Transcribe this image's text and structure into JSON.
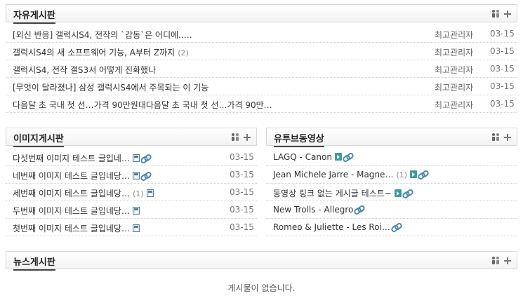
{
  "free_board": {
    "title": "자유게시판",
    "rows": [
      {
        "title": "[외신 반응] 갤럭시S4, 전작의 `감동`은 어디에..…",
        "comments": "",
        "author": "최고관리자",
        "date": "03-15"
      },
      {
        "title": "갤럭시S4의 새 소프트웨어 기능, A부터 Z까지",
        "comments": "(2)",
        "author": "최고관리자",
        "date": "03-15"
      },
      {
        "title": "갤럭시S4, 전작 갤S3서 어떻게 진화했나",
        "comments": "",
        "author": "최고관리자",
        "date": "03-15"
      },
      {
        "title": "[무엇이 달라졌나] 삼성 갤럭시S4에서 주목되는 이 기능",
        "comments": "",
        "author": "최고관리자",
        "date": "03-15"
      },
      {
        "title": "다음달 초 국내 첫 선…가격 90만원대다음달 초 국내 첫 선…가격 90만…",
        "comments": "",
        "author": "최고관리자",
        "date": "03-15"
      }
    ]
  },
  "image_board": {
    "title": "이미지게시판",
    "rows": [
      {
        "title": "다섯번째 이미지 테스트 글입네…",
        "comments": "",
        "date": "03-15",
        "icons": [
          "disk",
          "link"
        ]
      },
      {
        "title": "네번째 이미지 테스트 글입네당…",
        "comments": "",
        "date": "03-15",
        "icons": [
          "disk",
          "link"
        ]
      },
      {
        "title": "세번째 이미지 테스트 글입네당…",
        "comments": "(1)",
        "date": "03-15",
        "icons": [
          "disk"
        ]
      },
      {
        "title": "두번째 이미지 테스트 글입네당…",
        "comments": "",
        "date": "03-15",
        "icons": [
          "disk"
        ]
      },
      {
        "title": "첫번째 이미지 테스트 글입네당…",
        "comments": "",
        "date": "03-15",
        "icons": [
          "disk"
        ]
      }
    ]
  },
  "youtube_board": {
    "title": "유투브동영상",
    "rows": [
      {
        "title": "LAGQ - Canon",
        "comments": "",
        "icons": [
          "video",
          "link"
        ]
      },
      {
        "title": "Jean Michele Jarre - Magne…",
        "comments": "(1)",
        "icons": [
          "video",
          "link"
        ]
      },
      {
        "title": "동영상 링크 없는 게시글 테스트~",
        "comments": "",
        "icons": [
          "video",
          "link"
        ]
      },
      {
        "title": "New Trolls - Allegro",
        "comments": "",
        "icons": [
          "link"
        ]
      },
      {
        "title": "Romeo & Juliette - Les Roi…",
        "comments": "",
        "icons": [
          "link"
        ]
      }
    ]
  },
  "news_board": {
    "title": "뉴스게시판",
    "empty_message": "게시물이 없습니다."
  },
  "icons": {
    "header_members": "members-icon",
    "header_more": "plus-icon"
  },
  "colors": {
    "accent": "#444444",
    "link_icon": "#4d87a9",
    "video_icon": "#3f9aa0"
  }
}
